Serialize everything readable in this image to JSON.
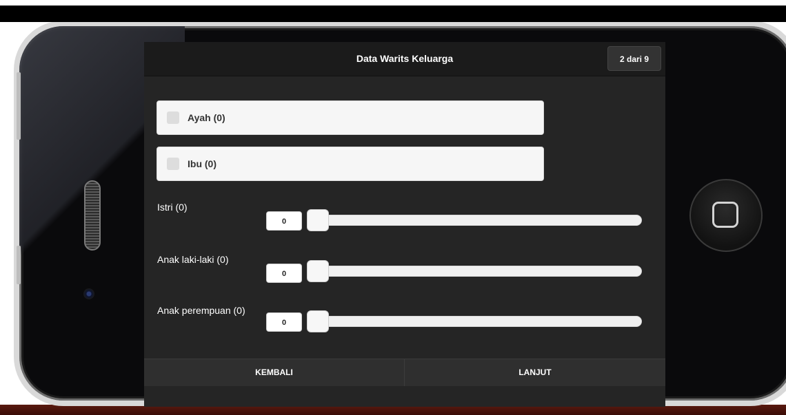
{
  "app": {
    "title": "Data Warits Keluarga",
    "page_indicator": "2 dari 9"
  },
  "checkboxes": [
    {
      "label": "Ayah (0)",
      "checked": false
    },
    {
      "label": "Ibu (0)",
      "checked": false
    }
  ],
  "sliders": [
    {
      "label": "Istri (0)",
      "value": "0"
    },
    {
      "label": "Anak laki-laki (0)",
      "value": "0"
    },
    {
      "label": "Anak perempuan (0)",
      "value": "0"
    }
  ],
  "footer": {
    "back_label": "KEMBALI",
    "next_label": "LANJUT"
  },
  "colors": {
    "screen_bg": "#252525",
    "header_bg": "#1b1b1b",
    "phone_body": "#0a0a0c"
  },
  "icons": {
    "home_button": "home-square-icon",
    "speaker": "speaker-grille-icon",
    "camera": "front-camera-icon"
  }
}
